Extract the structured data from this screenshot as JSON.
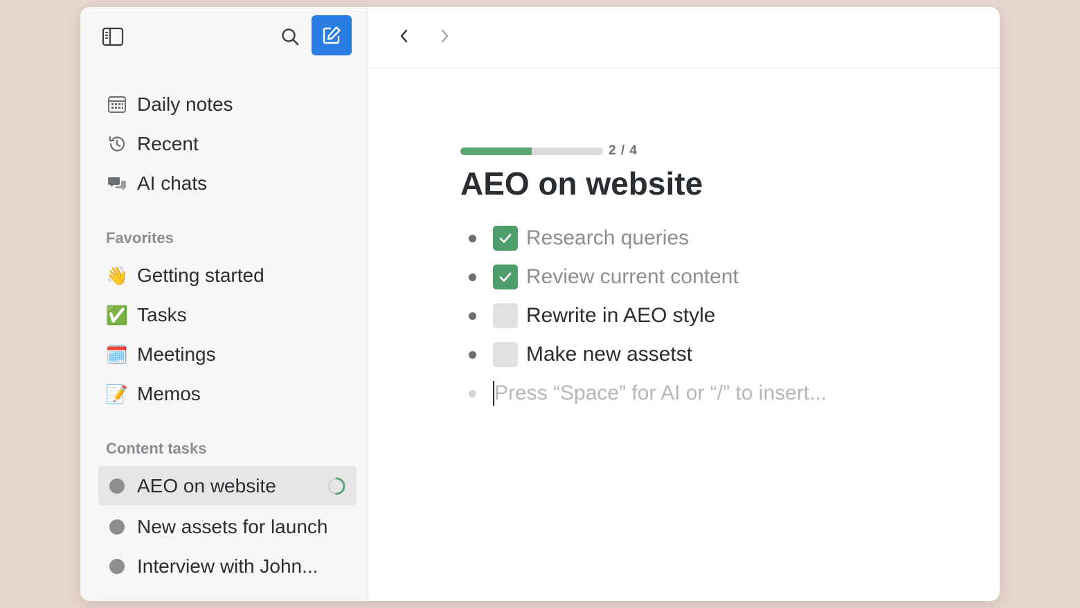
{
  "sidebar": {
    "nav": [
      {
        "label": "Daily notes",
        "icon": "calendar-icon"
      },
      {
        "label": "Recent",
        "icon": "history-icon"
      },
      {
        "label": "AI chats",
        "icon": "chat-icon"
      }
    ],
    "favorites_label": "Favorites",
    "favorites": [
      {
        "label": "Getting started",
        "emoji": "👋"
      },
      {
        "label": "Tasks",
        "emoji": "✅"
      },
      {
        "label": "Meetings",
        "emoji": "🗓️"
      },
      {
        "label": "Memos",
        "emoji": "📝"
      }
    ],
    "content_tasks_label": "Content tasks",
    "content_tasks": [
      {
        "label": "AEO on website",
        "active": true,
        "progress": 0.5
      },
      {
        "label": "New assets for launch"
      },
      {
        "label": "Interview with John..."
      }
    ]
  },
  "doc": {
    "progress": {
      "done": 2,
      "total": 4,
      "text": "2 / 4"
    },
    "title": "AEO on website",
    "todos": [
      {
        "text": "Research queries",
        "checked": true
      },
      {
        "text": "Review current content",
        "checked": true
      },
      {
        "text": "Rewrite in AEO style",
        "checked": false
      },
      {
        "text": "Make new assetst",
        "checked": false
      }
    ],
    "placeholder": "Press “Space” for AI or “/” to insert..."
  },
  "colors": {
    "accent": "#2a7de1",
    "check": "#4f9e6b",
    "progress": "#5aa676",
    "background": "#e8d8d0"
  }
}
